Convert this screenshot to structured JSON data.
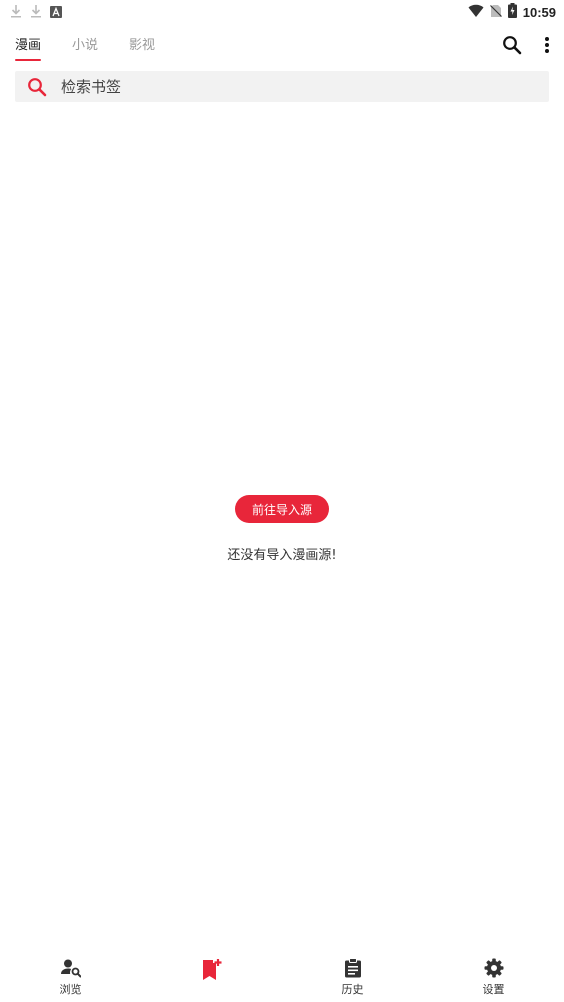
{
  "status_bar": {
    "time": "10:59",
    "left_icons": [
      "download-icon",
      "download-icon",
      "app-a-icon"
    ],
    "right_icons": [
      "wifi-icon",
      "no-sim-icon",
      "battery-charging-icon"
    ]
  },
  "tabs": [
    {
      "label": "漫画",
      "active": true
    },
    {
      "label": "小说",
      "active": false
    },
    {
      "label": "影视",
      "active": false
    }
  ],
  "top_actions": {
    "search_icon": "search-icon",
    "more_icon": "more-vertical-icon"
  },
  "search": {
    "placeholder": "检索书签",
    "value": ""
  },
  "empty_state": {
    "button_label": "前往导入源",
    "message": "还没有导入漫画源!"
  },
  "bottom_nav": [
    {
      "label": "浏览",
      "icon": "person-search-icon",
      "active": false
    },
    {
      "label": "",
      "icon": "bookmark-add-icon",
      "active": true
    },
    {
      "label": "历史",
      "icon": "clipboard-history-icon",
      "active": false
    },
    {
      "label": "设置",
      "icon": "gear-icon",
      "active": false
    }
  ],
  "colors": {
    "accent": "#e8263a",
    "text": "#222222",
    "muted": "#999999",
    "search_bg": "#f2f2f2"
  }
}
